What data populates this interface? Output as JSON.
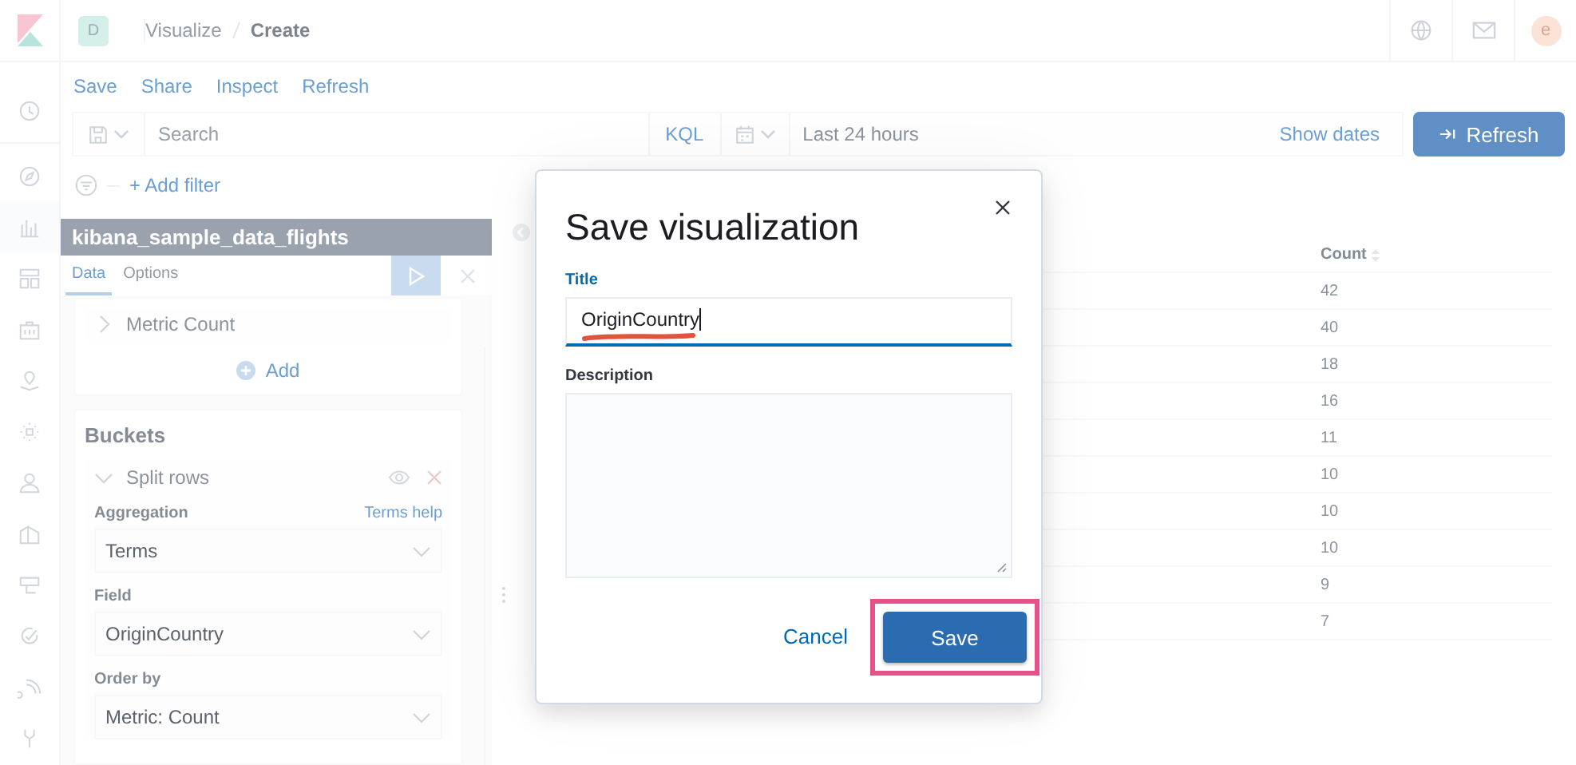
{
  "header": {
    "space_badge": "D",
    "breadcrumbs": [
      {
        "label": "Visualize",
        "current": false
      },
      {
        "label": "Create",
        "current": true
      }
    ],
    "avatar": "e"
  },
  "top_menu": [
    "Save",
    "Share",
    "Inspect",
    "Refresh"
  ],
  "query_bar": {
    "placeholder": "Search",
    "language": "KQL",
    "time_range": "Last 24 hours",
    "show_dates": "Show dates",
    "refresh_button": "Refresh"
  },
  "add_filter": "+ Add filter",
  "editor": {
    "index_pattern": "kibana_sample_data_flights",
    "tabs": [
      {
        "label": "Data",
        "selected": true
      },
      {
        "label": "Options",
        "selected": false
      }
    ],
    "metrics": [
      {
        "label": "Metric Count",
        "expanded": false
      }
    ],
    "add_button": "Add",
    "buckets": {
      "title": "Buckets",
      "items": [
        {
          "label": "Split rows",
          "expanded": true,
          "fields": [
            {
              "label": "Aggregation",
              "help_link": "Terms help",
              "value": "Terms"
            },
            {
              "label": "Field",
              "value": "OriginCountry"
            },
            {
              "label": "Order by",
              "value": "Metric: Count"
            }
          ]
        }
      ]
    }
  },
  "table": {
    "columns": [
      "Count"
    ],
    "rows": [
      [
        "42"
      ],
      [
        "40"
      ],
      [
        "18"
      ],
      [
        "16"
      ],
      [
        "11"
      ],
      [
        "10"
      ],
      [
        "10"
      ],
      [
        "10"
      ],
      [
        "9"
      ],
      [
        "7"
      ]
    ]
  },
  "modal": {
    "title": "Save visualization",
    "fields": [
      {
        "label": "Title",
        "kind": "input",
        "value": "OriginCountry",
        "focused": true,
        "underlined": true
      },
      {
        "label": "Description",
        "kind": "textarea",
        "focused": false,
        "underlined": false
      }
    ],
    "buttons": [
      {
        "label": "Cancel",
        "kind": "link",
        "highlighted": false
      },
      {
        "label": "Save",
        "kind": "primary",
        "highlighted": true
      }
    ]
  }
}
